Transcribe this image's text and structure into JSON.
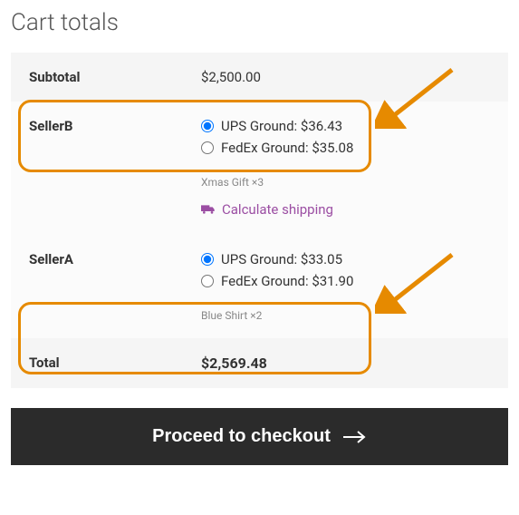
{
  "title": "Cart totals",
  "subtotal": {
    "label": "Subtotal",
    "value": "$2,500.00"
  },
  "sellers": [
    {
      "name": "SellerB",
      "options": [
        {
          "label": "UPS Ground: $36.43",
          "checked": true
        },
        {
          "label": "FedEx Ground: $35.08",
          "checked": false
        }
      ],
      "item_note": "Xmas Gift ×3",
      "show_calc": true
    },
    {
      "name": "SellerA",
      "options": [
        {
          "label": "UPS Ground: $33.05",
          "checked": true
        },
        {
          "label": "FedEx Ground: $31.90",
          "checked": false
        }
      ],
      "item_note": "Blue Shirt ×2",
      "show_calc": false
    }
  ],
  "calculate_shipping_label": "Calculate shipping",
  "total": {
    "label": "Total",
    "value": "$2,569.48"
  },
  "checkout_label": "Proceed to checkout"
}
